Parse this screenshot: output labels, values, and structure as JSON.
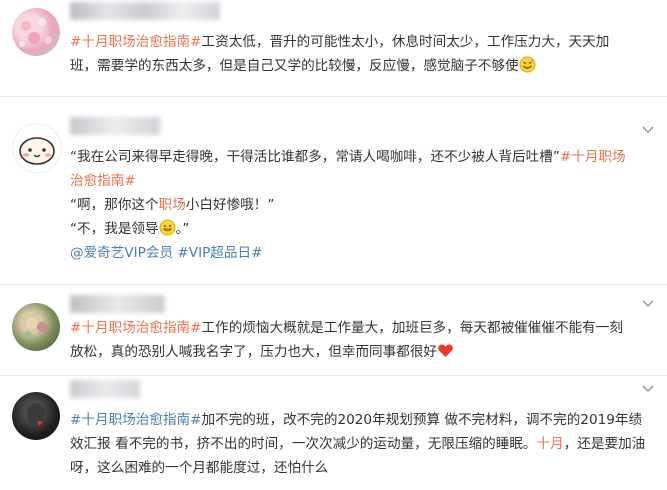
{
  "posts": [
    {
      "lines": [
        [
          "#十月职场治愈指南#",
          "工资太低，晋升的可能性太小，休息时间太少，工作压力大，天天加"
        ],
        [
          "班，需要学的东西太多，但是自己又学的比较慢，反应慢，感觉脑子不够使"
        ]
      ],
      "avatar_icon": "cherry-blossom-photo",
      "end_emoji": "sweat-smile-emoji"
    },
    {
      "lines": [
        [
          "“我在公司来得早走得晚，干得活比谁都多，常请人喝咖啡，还不少被人背后吐槽”",
          "#十月职场"
        ],
        [
          "治愈指南#"
        ],
        [
          "“啊，那你这个",
          "职场",
          "小白好惨哦！”"
        ],
        [
          "“不，我是领导",
          "。”"
        ],
        [
          "@爱奇艺VIP会员",
          "#VIP超品日#"
        ]
      ],
      "avatar_icon": "cartoon-face",
      "inline_emoji": "grin-emoji"
    },
    {
      "lines": [
        [
          "#十月职场治愈指南#",
          "工作的烦恼大概就是工作量大，加班巨多，每天都被催催催不能有一刻"
        ],
        [
          "放松，真的恐别人喊我名字了，压力也大，但幸而同事都很好"
        ]
      ],
      "avatar_icon": "flower-photo",
      "end_emoji": "red-heart-emoji"
    },
    {
      "lines": [
        [
          "#十月职场治愈指南#",
          "加不完的班，改不完的2020年规划预算 做不完材料，调不完的2019年绩"
        ],
        [
          "效汇报 看不完的书，挤不出的时间，一次次减少的运动量，无限压缩的睡眠。",
          "十月",
          "，还是要加油"
        ],
        [
          "呀，这么困难的一个月都能度过，还怕什么"
        ]
      ],
      "avatar_icon": "dark-portrait-photo"
    }
  ],
  "colors": {
    "topic": "#eb7350",
    "mention": "#507daf",
    "text": "#333333"
  }
}
